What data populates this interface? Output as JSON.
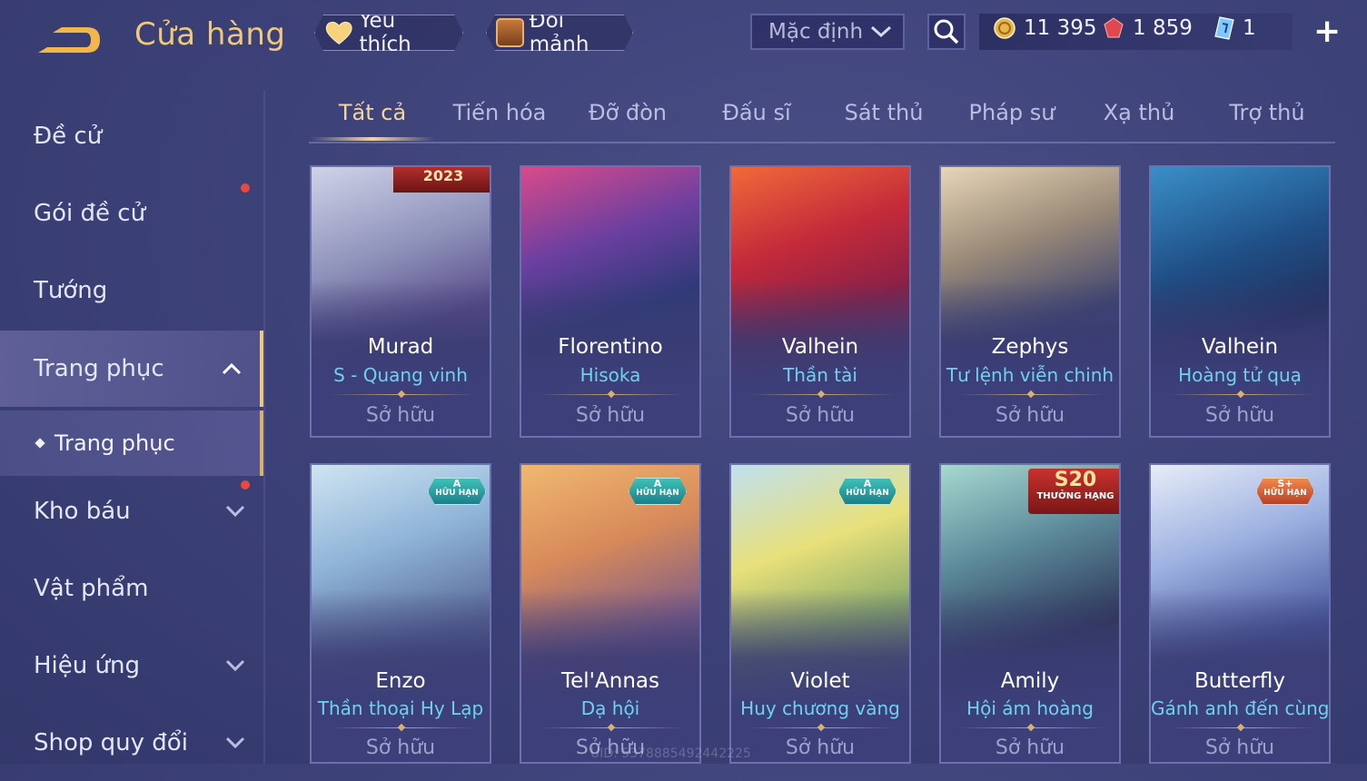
{
  "header": {
    "title": "Cửa hàng",
    "favorites_label": "Yêu thích",
    "exchange_label": "Đổi mảnh",
    "sort_value": "Mặc định",
    "currencies": [
      {
        "icon": "gold-coin-icon",
        "value": "11 395"
      },
      {
        "icon": "ruby-icon",
        "value": "1 859"
      },
      {
        "icon": "gem-ticket-icon",
        "value": "1"
      }
    ]
  },
  "sidebar": {
    "items": [
      {
        "label": "Đề cử"
      },
      {
        "label": "Gói đề cử"
      },
      {
        "label": "Tướng"
      },
      {
        "label": "Trang phục"
      },
      {
        "label": "Kho báu"
      },
      {
        "label": "Vật phẩm"
      },
      {
        "label": "Hiệu ứng"
      },
      {
        "label": "Shop quy đổi"
      }
    ],
    "sub_item": "Trang phục"
  },
  "tabs": [
    "Tất cả",
    "Tiến hóa",
    "Đỡ đòn",
    "Đấu sĩ",
    "Sát thủ",
    "Pháp sư",
    "Xạ thủ",
    "Trợ thủ"
  ],
  "cards": [
    {
      "hero": "Murad",
      "skin": "S - Quang vinh",
      "status": "Sở hữu",
      "banner": "2023"
    },
    {
      "hero": "Florentino",
      "skin": "Hisoka",
      "status": "Sở hữu"
    },
    {
      "hero": "Valhein",
      "skin": "Thần tài",
      "status": "Sở hữu"
    },
    {
      "hero": "Zephys",
      "skin": "Tư lệnh viễn chinh",
      "status": "Sở hữu"
    },
    {
      "hero": "Valhein",
      "skin": "Hoàng tử quạ",
      "status": "Sở hữu"
    },
    {
      "hero": "Enzo",
      "skin": "Thần thoại Hy Lạp",
      "status": "Sở hữu",
      "badge": "A",
      "badge_sub": "HỮU HẠN"
    },
    {
      "hero": "Tel'Annas",
      "skin": "Dạ hội",
      "status": "Sở hữu",
      "badge": "A",
      "badge_sub": "HỮU HẠN"
    },
    {
      "hero": "Violet",
      "skin": "Huy chương vàng",
      "status": "Sở hữu",
      "badge": "A",
      "badge_sub": "HỮU HẠN"
    },
    {
      "hero": "Amily",
      "skin": "Hội ám hoàng",
      "status": "Sở hữu",
      "banner": "S20",
      "banner_sub": "THƯỞNG HẠNG"
    },
    {
      "hero": "Butterfly",
      "skin": "Gánh anh đến cùng",
      "status": "Sở hữu",
      "badge": "S+",
      "badge_sub": "HỮU HẠN"
    }
  ],
  "watermark": "UID: 5378885492442225",
  "colors": {
    "accent_gold": "#f0c87a",
    "skin_name": "#6fd0ef",
    "background": "#3d4279"
  }
}
